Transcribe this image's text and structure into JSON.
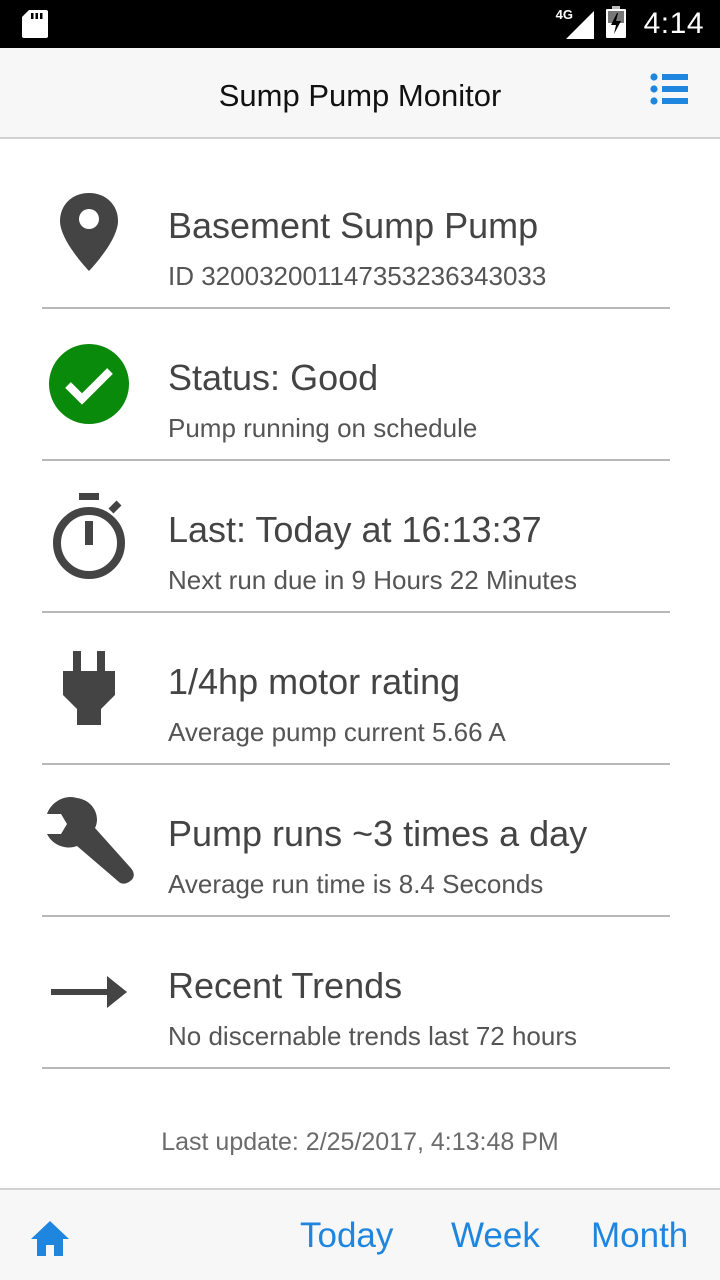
{
  "status_bar": {
    "network": "4G",
    "time": "4:14",
    "icons": [
      "sd-card-icon",
      "signal-icon",
      "battery-icon"
    ]
  },
  "app_bar": {
    "title": "Sump Pump Monitor",
    "menu_icon": "list-menu-icon"
  },
  "items": [
    {
      "icon": "location-pin-icon",
      "title": "Basement Sump Pump",
      "subtitle": "ID 320032001147353236343033"
    },
    {
      "icon": "check-circle-icon",
      "title": "Status: Good",
      "subtitle": "Pump running on schedule"
    },
    {
      "icon": "stopwatch-icon",
      "title": "Last: Today at 16:13:37",
      "subtitle": "Next run due in 9 Hours 22 Minutes"
    },
    {
      "icon": "plug-icon",
      "title": "1/4hp motor rating",
      "subtitle": "Average pump current 5.66 A"
    },
    {
      "icon": "wrench-icon",
      "title": "Pump runs ~3 times a day",
      "subtitle": "Average run time is 8.4 Seconds"
    },
    {
      "icon": "arrow-right-icon",
      "title": "Recent Trends",
      "subtitle": "No discernable trends last 72 hours"
    }
  ],
  "last_update": "Last update: 2/25/2017, 4:13:48 PM",
  "bottom_nav": {
    "home_icon": "home-icon",
    "today": "Today",
    "week": "Week",
    "month": "Month"
  },
  "colors": {
    "accent": "#1f86e0",
    "status_good": "#0a8a0a",
    "icon_gray": "#444444"
  }
}
